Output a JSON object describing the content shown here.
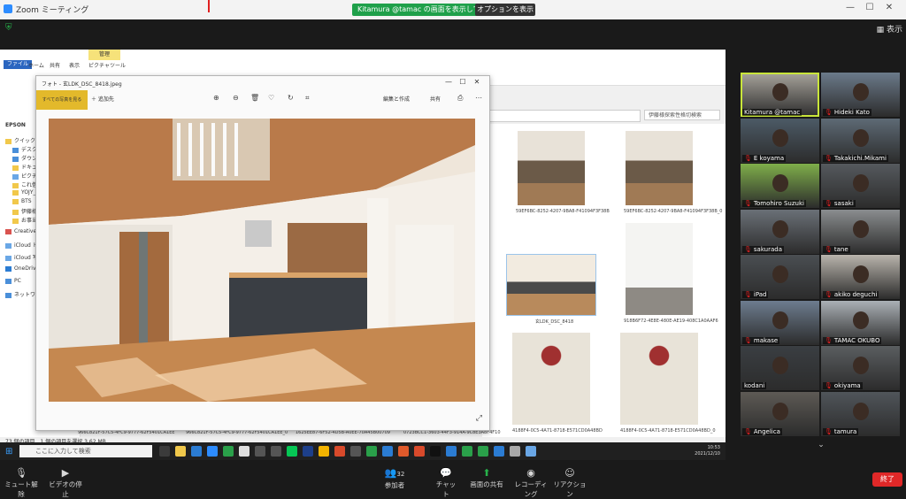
{
  "zoom": {
    "title": "Zoom ミーティング",
    "share_banner": "Kitamura @tamac の画面を表示しています",
    "view_options": "オプションを表示 ▾",
    "gallery_view": "表示"
  },
  "explorer": {
    "manage_tab": "管理",
    "ribbon_tabs": [
      "ファイル",
      "ホーム",
      "共有",
      "表示",
      "ピクチャツール"
    ],
    "search_placeholder": "伊藤様探索性格切検索",
    "nav_items": [
      "EPSON",
      "クイック アクセス",
      "デスクトップ",
      "ダウンロード",
      "ドキュメント",
      "ピクチャ",
      "これ借",
      "YOJY_...",
      "BTS",
      "伊藤様...",
      "お事当",
      "Creative Cloud",
      "iCloud ドライブ",
      "iCloud 写真",
      "OneDrive",
      "PC",
      "ネットワーク"
    ],
    "thumbnails": [
      {
        "label": "59EF6BC-8252-4207-9BA8-F41094F3F38B"
      },
      {
        "label": "59EF6BC-8252-4207-9BA8-F41094F3F38B_0"
      },
      {
        "label": "玄LDK_DSC_8418"
      },
      {
        "label": "918B6F72-4E8E-480E-AE19-408C1A0AAF6"
      },
      {
        "label": "4188F4-0C5-4A71-8718-E571CD0A48BD"
      },
      {
        "label": "4188F4-0C5-4A71-8718-E571CD0A48BD_0"
      }
    ],
    "bottom_labels": [
      "966C821F-57C5-4FC9-9777-62F5401CA1EE",
      "966C821F-57C5-4FC9-9777-62F5401CA1EE_0",
      "1625EE87-6F52-4D5B-A0EE-70A45B00709",
      "0723BCC1-3603-44F3-914A-9C8E3A8F4F10"
    ],
    "status": "73 個の項目　1 個の項目を選択 3.62 MB"
  },
  "photo_viewer": {
    "title": "フォト - 玄LDK_DSC_8418.jpeg",
    "add_photo": "すべての写真を見る",
    "add": "追加先",
    "edit": "編集と作成",
    "share": "共有"
  },
  "taskbar": {
    "search": "ここに入力して検索",
    "time": "10:53",
    "date": "2021/12/10"
  },
  "participants": [
    {
      "name": "Kitamura @tamac",
      "muted": false
    },
    {
      "name": "Hideki Kato",
      "muted": true
    },
    {
      "name": "E koyama",
      "muted": true
    },
    {
      "name": "Takakichi.Mikami",
      "muted": true
    },
    {
      "name": "Tomohiro Suzuki",
      "muted": true
    },
    {
      "name": "sasaki",
      "muted": true
    },
    {
      "name": "sakurada",
      "muted": true
    },
    {
      "name": "tane",
      "muted": true
    },
    {
      "name": "iPad",
      "muted": true
    },
    {
      "name": "akiko deguchi",
      "muted": true
    },
    {
      "name": "makase",
      "muted": true
    },
    {
      "name": "TAMAC OKUBO",
      "muted": true
    },
    {
      "name": "kodani",
      "muted": false
    },
    {
      "name": "okiyama",
      "muted": true
    },
    {
      "name": "Angelica",
      "muted": true
    },
    {
      "name": "tamura",
      "muted": true
    }
  ],
  "toolbar": {
    "unmute": "ミュート解除",
    "video": "ビデオの停止",
    "participants": "参加者",
    "participants_count": "32",
    "chat": "チャット",
    "share": "画面の共有",
    "record": "レコーディング",
    "reactions": "リアクション",
    "end": "終了"
  }
}
